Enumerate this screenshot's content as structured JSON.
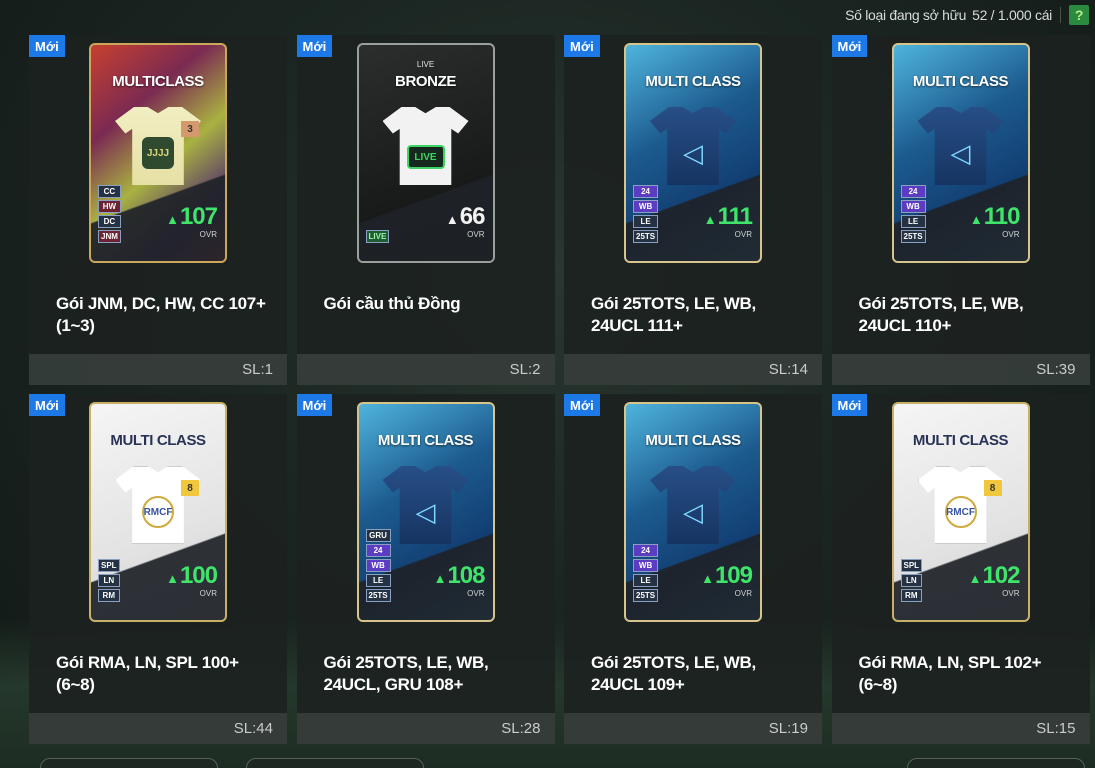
{
  "header": {
    "owned_label": "Số loại đang sở hữu",
    "owned_count": "52 / 1.000 cái",
    "help_label": "?"
  },
  "new_label": "Mới",
  "ovr_label": "OVR",
  "packs": [
    {
      "pack_label": "MULTICLASS",
      "pack_sub": "",
      "theme": "multi",
      "crest": "JJJJ",
      "level": "3",
      "chips": [
        "CC",
        "HW",
        "DC",
        "JNM"
      ],
      "ovr_value": "107",
      "ovr_style": "green",
      "name": "Gói JNM, DC, HW, CC 107+ (1~3)",
      "qty": "SL:1"
    },
    {
      "pack_label": "BRONZE",
      "pack_sub": "LIVE",
      "theme": "bronze",
      "crest": "LIVE",
      "level": "",
      "chips": [
        "LIVE"
      ],
      "ovr_value": "66",
      "ovr_style": "white",
      "name": "Gói cầu thủ Đồng",
      "qty": "SL:2"
    },
    {
      "pack_label": "MULTI CLASS",
      "pack_sub": "",
      "theme": "tots",
      "crest": "◁",
      "level": "",
      "chips": [
        "24",
        "WB",
        "LE",
        "25TS"
      ],
      "ovr_value": "111",
      "ovr_style": "green",
      "name": "Gói 25TOTS, LE, WB, 24UCL 111+",
      "qty": "SL:14"
    },
    {
      "pack_label": "MULTI CLASS",
      "pack_sub": "",
      "theme": "tots",
      "crest": "◁",
      "level": "",
      "chips": [
        "24",
        "WB",
        "LE",
        "25TS"
      ],
      "ovr_value": "110",
      "ovr_style": "green",
      "name": "Gói 25TOTS, LE, WB, 24UCL 110+",
      "qty": "SL:39"
    },
    {
      "pack_label": "MULTI CLASS",
      "pack_sub": "",
      "theme": "rma",
      "crest": "RMCF",
      "level": "8",
      "chips": [
        "SPL",
        "LN",
        "RM"
      ],
      "ovr_value": "100",
      "ovr_style": "green",
      "name": "Gói RMA, LN, SPL 100+ (6~8)",
      "qty": "SL:44"
    },
    {
      "pack_label": "MULTI CLASS",
      "pack_sub": "",
      "theme": "tots",
      "crest": "◁",
      "level": "",
      "chips": [
        "GRU",
        "24",
        "WB",
        "LE",
        "25TS"
      ],
      "ovr_value": "108",
      "ovr_style": "green",
      "name": "Gói 25TOTS, LE, WB, 24UCL, GRU 108+",
      "qty": "SL:28"
    },
    {
      "pack_label": "MULTI CLASS",
      "pack_sub": "",
      "theme": "tots",
      "crest": "◁",
      "level": "",
      "chips": [
        "24",
        "WB",
        "LE",
        "25TS"
      ],
      "ovr_value": "109",
      "ovr_style": "green",
      "name": "Gói 25TOTS, LE, WB, 24UCL 109+",
      "qty": "SL:19"
    },
    {
      "pack_label": "MULTI CLASS",
      "pack_sub": "",
      "theme": "rma",
      "crest": "RMCF",
      "level": "8",
      "chips": [
        "SPL",
        "LN",
        "RM"
      ],
      "ovr_value": "102",
      "ovr_style": "green",
      "name": "Gói RMA, LN, SPL 102+ (6~8)",
      "qty": "SL:15"
    }
  ]
}
